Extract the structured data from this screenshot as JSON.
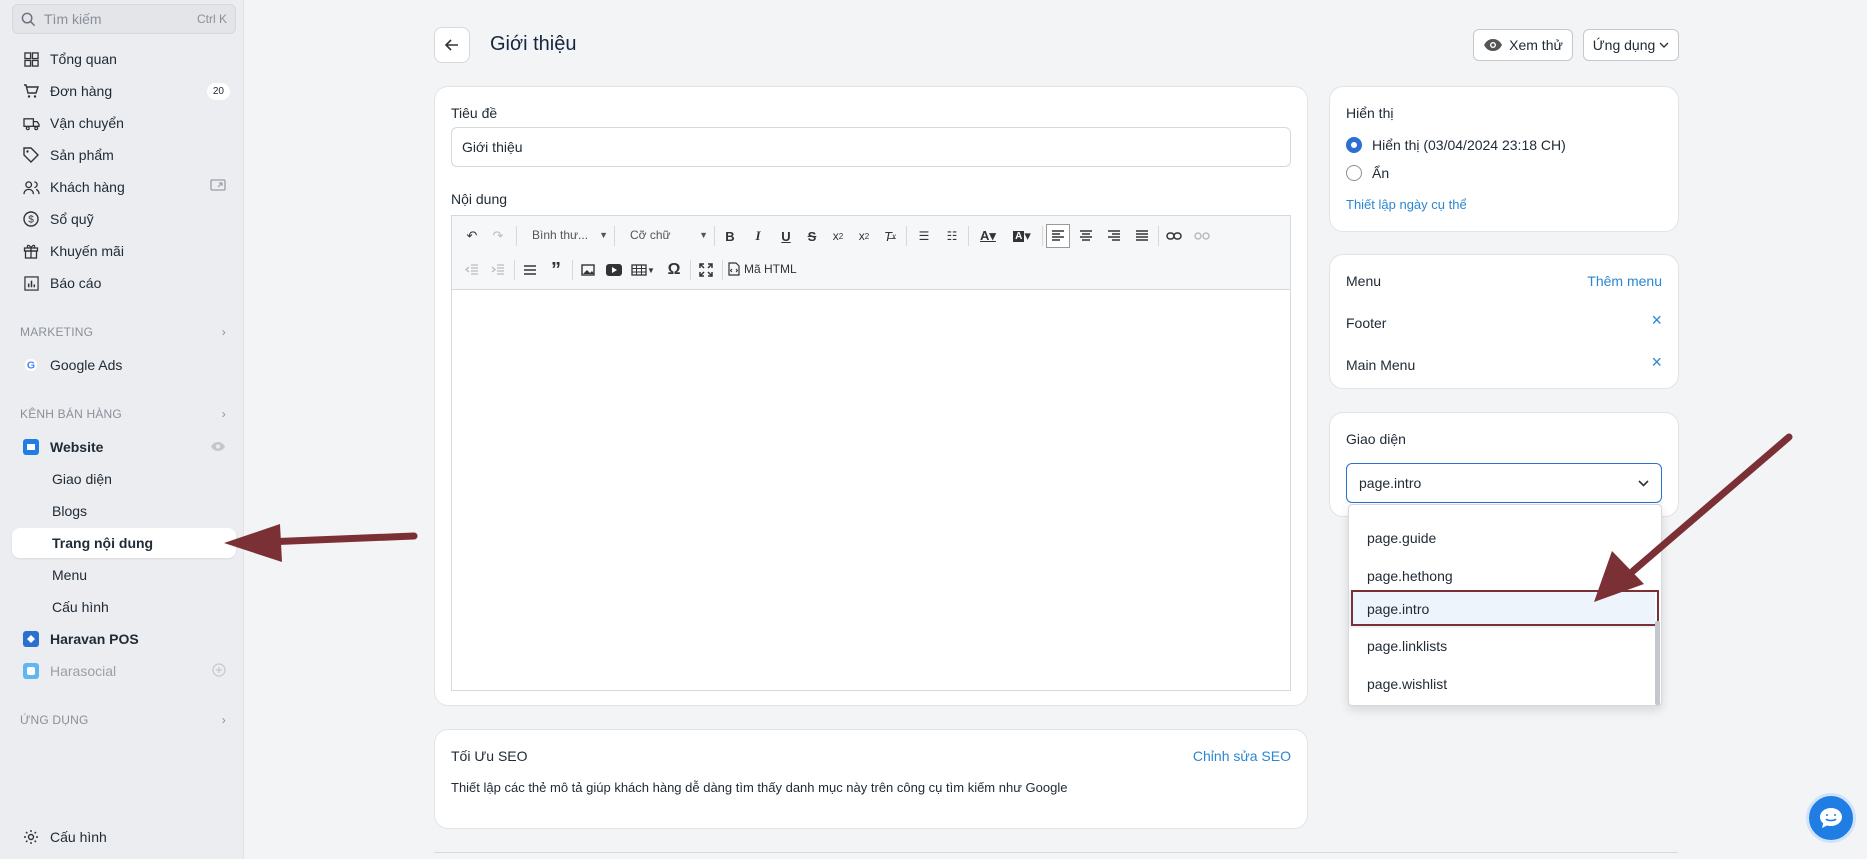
{
  "sidebar": {
    "search_placeholder": "Tìm kiếm",
    "search_shortcut": "Ctrl K",
    "items": [
      {
        "label": "Tổng quan",
        "icon": "dashboard-icon"
      },
      {
        "label": "Đơn hàng",
        "icon": "cart-icon",
        "badge": "20"
      },
      {
        "label": "Vận chuyển",
        "icon": "truck-icon"
      },
      {
        "label": "Sản phẩm",
        "icon": "tag-icon"
      },
      {
        "label": "Khách hàng",
        "icon": "users-icon"
      },
      {
        "label": "Sổ quỹ",
        "icon": "dollar-icon"
      },
      {
        "label": "Khuyến mãi",
        "icon": "gift-icon"
      },
      {
        "label": "Báo cáo",
        "icon": "chart-icon"
      }
    ],
    "marketing_label": "MARKETING",
    "google_ads": "Google Ads",
    "sales_channels_label": "KÊNH BÁN HÀNG",
    "website": "Website",
    "website_subitems": [
      "Giao diện",
      "Blogs",
      "Trang nội dung",
      "Menu",
      "Cấu hình"
    ],
    "haravan_pos": "Haravan POS",
    "harasocial": "Harasocial",
    "apps_label": "ỨNG DỤNG",
    "settings": "Cấu hình"
  },
  "header": {
    "title": "Giới thiệu",
    "preview_label": "Xem thử",
    "apps_label": "Ứng dụng"
  },
  "form": {
    "title_label": "Tiêu đề",
    "title_value": "Giới thiệu",
    "content_label": "Nội dung",
    "format_select": "Bình thư...",
    "font_size_select": "Cỡ chữ",
    "html_label": "Mã HTML"
  },
  "seo": {
    "title": "Tối Ưu SEO",
    "edit_link": "Chỉnh sửa SEO",
    "description": "Thiết lập các thẻ mô tả giúp khách hàng dễ dàng tìm thấy danh mục này trên công cụ tìm kiếm như Google"
  },
  "visibility": {
    "title": "Hiển thị",
    "option_visible": "Hiển thị (03/04/2024 23:18 CH)",
    "option_hidden": "Ẩn",
    "schedule_link": "Thiết lập ngày cụ thể"
  },
  "menu_card": {
    "title": "Menu",
    "add_link": "Thêm menu",
    "items": [
      "Footer",
      "Main Menu"
    ]
  },
  "theme_card": {
    "title": "Giao diện",
    "selected": "page.intro",
    "options": [
      "page.guide",
      "page.hethong",
      "page.intro",
      "page.linklists",
      "page.wishlist"
    ]
  },
  "colors": {
    "accent": "#2b87d1",
    "annotation": "#7b3035"
  }
}
